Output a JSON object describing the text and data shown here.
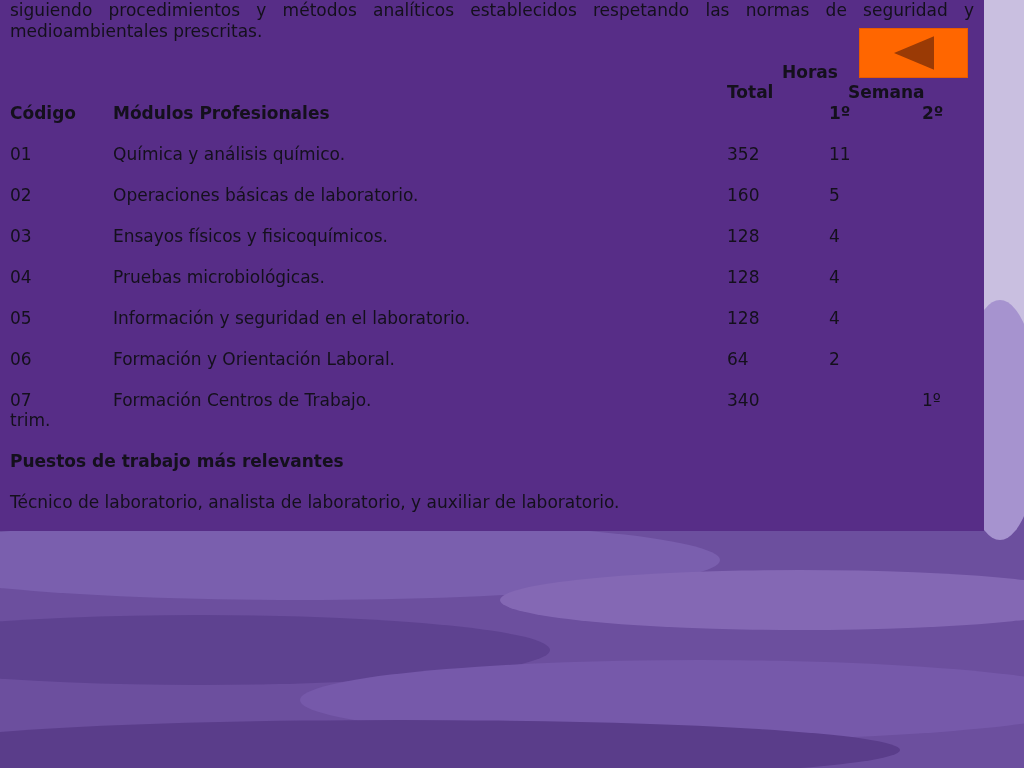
{
  "intro": "siguiendo procedimientos y métodos analíticos establecidos respetando las normas de seguridad y medioambientales prescritas.",
  "table": {
    "header": {
      "hours": "Horas",
      "total": "Total",
      "week": "Semana",
      "code": "Código",
      "module": "Módulos Profesionales",
      "year_1": "1º",
      "year_2": "2º"
    },
    "rows": [
      {
        "code": "01",
        "module": "Química y análisis químico.",
        "total": "352",
        "year_1": "11"
      },
      {
        "code": "02",
        "module": "Operaciones básicas de laboratorio.",
        "total": "160",
        "year_1": "5"
      },
      {
        "code": "03",
        "module": "Ensayos físicos y fisicoquímicos.",
        "total": "128",
        "year_1": "4"
      },
      {
        "code": "04",
        "module": "Pruebas microbiológicas.",
        "total": "128",
        "year_1": "4"
      },
      {
        "code": "05",
        "module": "Información y seguridad en el laboratorio.",
        "total": "128",
        "year_1": "4"
      },
      {
        "code": "06",
        "module": "Formación y Orientación Laboral.",
        "total": "64",
        "year_1": "2"
      },
      {
        "code": "07",
        "module": "Formación Centros de Trabajo.",
        "total": "340",
        "year_2": "1º",
        "year_2_continued": "trim."
      }
    ]
  },
  "jobs": {
    "title": "Puestos de trabajo más relevantes",
    "text": "Técnico de laboratorio, analista de laboratorio, y auxiliar de laboratorio."
  },
  "back_button": {
    "kind": "back"
  }
}
